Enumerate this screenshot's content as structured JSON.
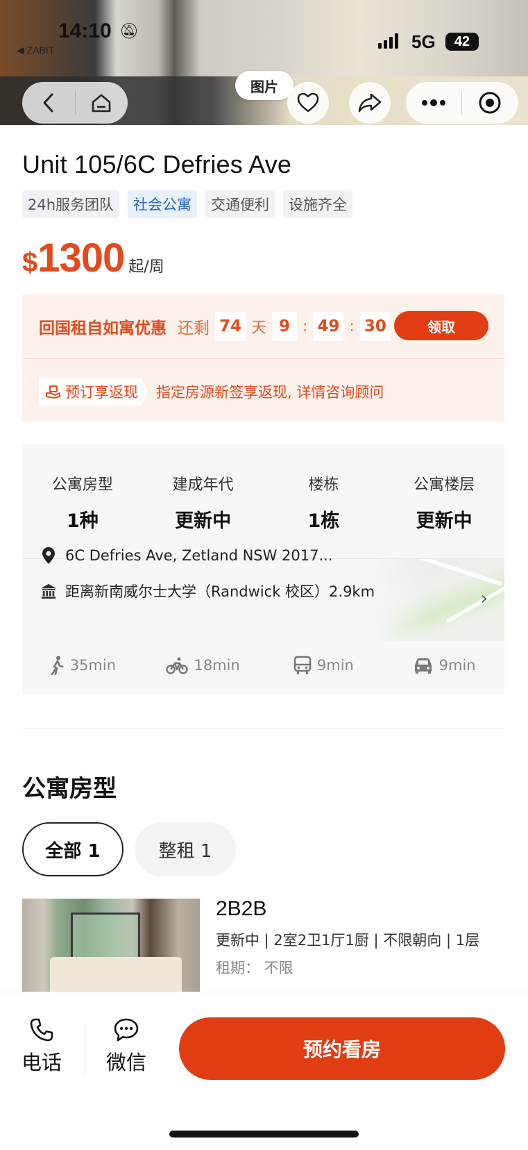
{
  "status_bar": {
    "time": "14:10",
    "back_app": "◀ ZABIT",
    "network": "5G",
    "battery": "42"
  },
  "hero": {
    "photo_label": "图片"
  },
  "listing": {
    "title": "Unit 105/6C Defries Ave",
    "tags": [
      "24h服务团队",
      "社会公寓",
      "交通便利",
      "设施齐全"
    ],
    "price": {
      "currency": "$",
      "amount": "1300",
      "unit": "起/周"
    }
  },
  "promo": {
    "title": "回国租自如寓优惠",
    "remaining_label": "还剩",
    "days": "74",
    "days_unit": "天",
    "hours": "9",
    "minutes": "49",
    "seconds": "30",
    "separator": ":",
    "claim_label": "领取",
    "rebate_badge": "预订享返现",
    "rebate_text": "指定房源新签享返现, 详情咨询顾问"
  },
  "stats": [
    {
      "label": "公寓房型",
      "value": "1种"
    },
    {
      "label": "建成年代",
      "value": "更新中"
    },
    {
      "label": "楼栋",
      "value": "1栋"
    },
    {
      "label": "公寓楼层",
      "value": "更新中"
    }
  ],
  "location": {
    "address": "6C Defries Ave, Zetland NSW 2017...",
    "university": "距离新南威尔士大学（Randwick 校区）2.9km",
    "travel": {
      "walk": "35min",
      "bike": "18min",
      "bus": "9min",
      "car": "9min"
    }
  },
  "room_types": {
    "section_title": "公寓房型",
    "filters": [
      "全部 1",
      "整租 1"
    ],
    "room": {
      "name": "2B2B",
      "desc": "更新中 | 2室2卫1厅1厨 | 不限朝向 | 1层",
      "term": "租期：  不限"
    }
  },
  "bottom_bar": {
    "phone_label": "电话",
    "wechat_label": "微信",
    "book_label": "预约看房"
  },
  "colors": {
    "accent": "#e03d12",
    "price": "#e24b1c",
    "promo_bg": "#fdf1ec",
    "tag_blue": "#2e67b8"
  }
}
